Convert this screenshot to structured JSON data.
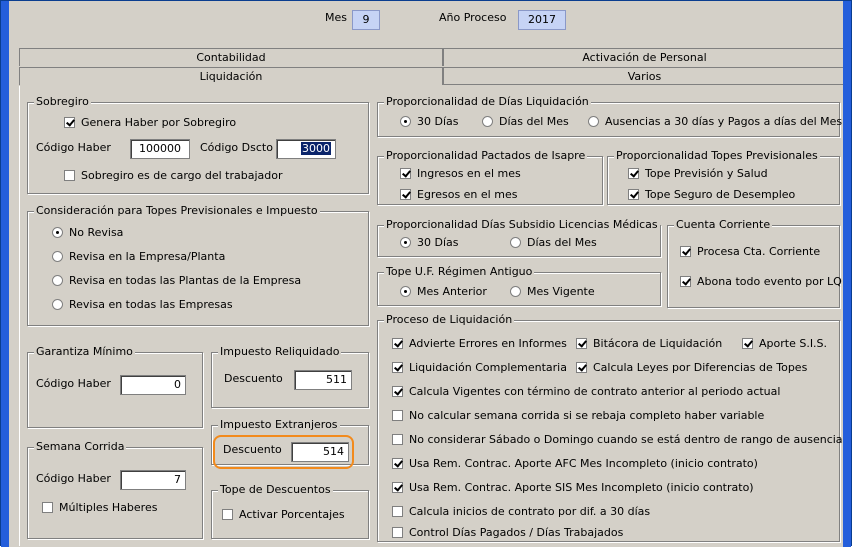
{
  "header": {
    "mes_label": "Mes",
    "mes_value": "9",
    "anio_label": "Año Proceso",
    "anio_value": "2017"
  },
  "tabs": {
    "row1": [
      "Contabilidad",
      "Activación de Personal"
    ],
    "row2": [
      "Liquidación",
      "Varios"
    ],
    "active": "Liquidación"
  },
  "sobregiro": {
    "title": "Sobregiro",
    "genera": {
      "label": "Genera Haber por Sobregiro",
      "checked": true
    },
    "codigo_haber_label": "Código Haber",
    "codigo_haber_value": "100000",
    "codigo_dscto_label": "Código Dscto",
    "codigo_dscto_value": "3000",
    "cargo": {
      "label": "Sobregiro es de cargo del trabajador",
      "checked": false
    }
  },
  "topes": {
    "title": "Consideración para Topes Previsionales e Impuesto",
    "options": [
      {
        "label": "No Revisa",
        "checked": true
      },
      {
        "label": "Revisa en la Empresa/Planta",
        "checked": false
      },
      {
        "label": "Revisa en todas las Plantas de la Empresa",
        "checked": false
      },
      {
        "label": "Revisa en todas las Empresas",
        "checked": false
      }
    ]
  },
  "garantiza": {
    "title": "Garantiza Mínimo",
    "codigo_label": "Código Haber",
    "codigo_value": "0"
  },
  "imp_reliq": {
    "title": "Impuesto Reliquidado",
    "desc_label": "Descuento",
    "desc_value": "511"
  },
  "imp_ext": {
    "title": "Impuesto Extranjeros",
    "desc_label": "Descuento",
    "desc_value": "514"
  },
  "semana": {
    "title": "Semana Corrida",
    "codigo_label": "Código Haber",
    "codigo_value": "7",
    "multiples": {
      "label": "Múltiples Haberes",
      "checked": false
    }
  },
  "tope_desc": {
    "title": "Tope de Descuentos",
    "activar": {
      "label": "Activar Porcentajes",
      "checked": false
    }
  },
  "prop_dias": {
    "title": "Proporcionalidad de Días Liquidación",
    "options": [
      {
        "label": "30 Días",
        "checked": true
      },
      {
        "label": "Días del Mes",
        "checked": false
      },
      {
        "label": "Ausencias a 30 días y Pagos a días del Mes",
        "checked": false
      }
    ]
  },
  "prop_isapre": {
    "title": "Proporcionalidad Pactados de Isapre",
    "items": [
      {
        "label": "Ingresos en el mes",
        "checked": true
      },
      {
        "label": "Egresos en el mes",
        "checked": true
      }
    ]
  },
  "prop_topes": {
    "title": "Proporcionalidad Topes Previsionales",
    "items": [
      {
        "label": "Tope Previsión y Salud",
        "checked": true
      },
      {
        "label": "Tope Seguro de Desempleo",
        "checked": true
      }
    ]
  },
  "subsidio": {
    "title": "Proporcionalidad Días Subsidio Licencias Médicas",
    "options": [
      {
        "label": "30 Días",
        "checked": true
      },
      {
        "label": "Días del Mes",
        "checked": false
      }
    ]
  },
  "cuenta": {
    "title": "Cuenta Corriente",
    "items": [
      {
        "label": "Procesa Cta. Corriente",
        "checked": true
      },
      {
        "label": "Abona todo evento por LQ",
        "checked": true
      }
    ]
  },
  "uf": {
    "title": "Tope U.F. Régimen Antiguo",
    "options": [
      {
        "label": "Mes Anterior",
        "checked": true
      },
      {
        "label": "Mes Vigente",
        "checked": false
      }
    ]
  },
  "proceso": {
    "title": "Proceso de Liquidación",
    "row1": [
      {
        "label": "Advierte Errores en Informes",
        "checked": true
      },
      {
        "label": "Bitácora de Liquidación",
        "checked": true
      },
      {
        "label": "Aporte S.I.S.",
        "checked": true
      }
    ],
    "row2": [
      {
        "label": "Liquidación Complementaria",
        "checked": true
      },
      {
        "label": "Calcula Leyes por Diferencias de Topes",
        "checked": true
      }
    ],
    "rows": [
      {
        "label": "Calcula Vigentes con término de contrato anterior al periodo actual",
        "checked": true
      },
      {
        "label": "No calcular semana corrida si se rebaja completo haber variable",
        "checked": false
      },
      {
        "label": "No considerar Sábado o Domingo cuando se está dentro de rango de ausencia",
        "checked": false
      },
      {
        "label": "Usa Rem. Contrac. Aporte AFC Mes Incompleto (inicio contrato)",
        "checked": true
      },
      {
        "label": "Usa Rem. Contrac. Aporte SIS Mes Incompleto (inicio contrato)",
        "checked": true
      },
      {
        "label": "Calcula inicios de contrato por dif. a 30 días",
        "checked": false
      },
      {
        "label": "Control Días Pagados / Días Trabajados",
        "checked": false
      }
    ]
  },
  "colors": {
    "frame": "#245edb",
    "highlight": "#f28a1c",
    "field_blue": "#c6d3f5"
  }
}
